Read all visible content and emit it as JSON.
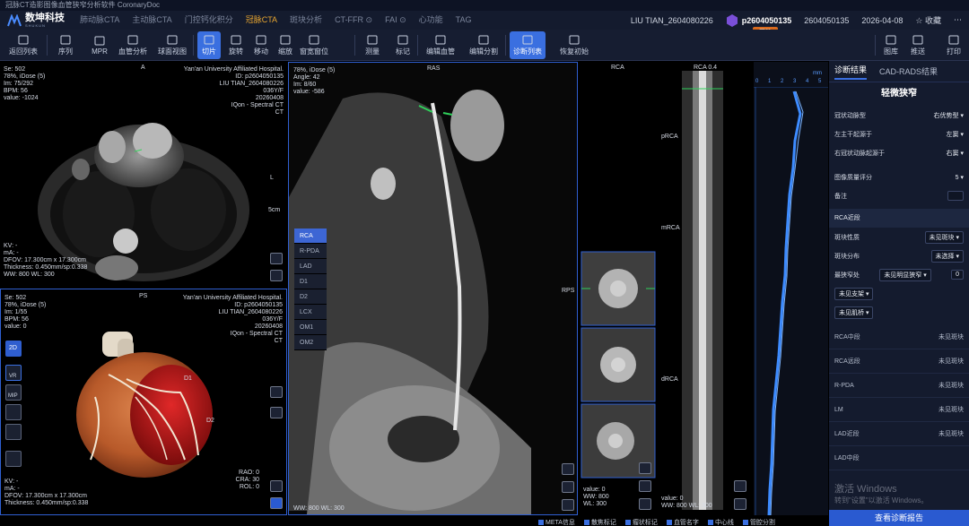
{
  "app": {
    "window_title": "冠脉CT造影图像血管狭窄分析软件 CoronaryDoc"
  },
  "brand": {
    "name": "数坤科技",
    "sub": "SHUKUN"
  },
  "nav": {
    "tabs": [
      "肺动脉CTA",
      "主动脉CTA",
      "门控钙化积分",
      "冠脉CTA",
      "斑块分析",
      "CT-FFR ⊙",
      "FAI ⊙",
      "心功能",
      "TAG"
    ],
    "active_index": 3,
    "user": "LIU TIAN_2604080226",
    "patient_id": "p2604050135",
    "study_id": "2604050135",
    "date": "2026-04-08",
    "favorite_label": "收藏",
    "badge": "冠脉"
  },
  "toolbar": {
    "buttons": [
      {
        "label": "返回列表",
        "icon": "back-icon"
      },
      {
        "label": "序列",
        "icon": "sequence-icon"
      },
      {
        "label": "MPR",
        "icon": "mpr-icon"
      },
      {
        "label": "血管分析",
        "icon": "vessel-analysis-icon"
      },
      {
        "label": "球面视图",
        "icon": "sphere-view-icon"
      },
      {
        "label": "切片",
        "icon": "slice-icon"
      },
      {
        "label": "旋转",
        "icon": "rotate-icon"
      },
      {
        "label": "移动",
        "icon": "move-icon"
      },
      {
        "label": "缩放",
        "icon": "zoom-icon"
      },
      {
        "label": "窗宽窗位",
        "icon": "window-level-icon"
      },
      {
        "label": "测量",
        "icon": "measure-icon"
      },
      {
        "label": "标记",
        "icon": "mark-icon"
      },
      {
        "label": "编辑血管",
        "icon": "edit-vessel-icon"
      },
      {
        "label": "编辑分割",
        "icon": "edit-segmentation-icon"
      },
      {
        "label": "诊断列表",
        "icon": "diagnosis-list-icon"
      },
      {
        "label": "恢复初始",
        "icon": "reset-icon"
      },
      {
        "label": "图库",
        "icon": "gallery-icon"
      },
      {
        "label": "推送",
        "icon": "push-icon"
      },
      {
        "label": "打印",
        "icon": "print-icon"
      }
    ]
  },
  "viewer_axial": {
    "orientation": "A",
    "left_info": [
      "Se: 502",
      "78%, iDose (5)",
      "Im: 75/292",
      "BPM: 56",
      "value: -1024"
    ],
    "right_info": [
      "Yan'an University Affiliated Hospital.",
      "ID: p2604050135",
      "LIU TIAN_2604080226",
      "036Y/F",
      "20260408",
      "IQon - Spectral CT",
      "CT"
    ],
    "bottom_info": [
      "KV: -",
      "mA: -",
      "DFOV: 17.300cm x 17.300cm",
      "Thickness: 0.450mm/sp:0.338",
      "WW: 800    WL: 300"
    ],
    "scale_label": "5cm",
    "left_marker": "L"
  },
  "viewer_3d": {
    "orientation": "PS",
    "left_info": [
      "Se: 502",
      "78%, iDose (5)",
      "Im: 1/55",
      "BPM: 56",
      "value: 0"
    ],
    "right_info": [
      "Yan'an University Affiliated Hospital.",
      "ID: p2604050135",
      "LIU TIAN_2604080226",
      "036Y/F",
      "20260408",
      "IQon - Spectral CT",
      "CT"
    ],
    "bottom_info": [
      "KV: -",
      "mA: -",
      "DFOV: 17.300cm x 17.300cm",
      "Thickness: 0.450mm/sp:0.338"
    ],
    "angles": [
      "RAO: 0",
      "CRA: 30",
      "ROL: 0"
    ],
    "labels": {
      "d1": "D1",
      "d2": "D2"
    },
    "side_tools": [
      "2D",
      "VR",
      "MIP",
      "",
      "",
      ""
    ]
  },
  "viewer_cpr": {
    "orientation": "RAS",
    "left_info": [
      "78%, iDose (5)",
      "Angle: 42",
      "Im: 8/60",
      "value: -586"
    ],
    "bottom_info": "WW: 800    WL: 300",
    "vessels": [
      "RCA",
      "R-PDA",
      "LAD",
      "D1",
      "D2",
      "LCX",
      "OM1",
      "OM2"
    ],
    "active_vessel": "RCA",
    "rps_label": "RPS"
  },
  "viewer_cross": {
    "title": "RCA",
    "bottom_info": [
      "value: 0",
      "WW: 800",
      "WL: 300"
    ]
  },
  "viewer_straight": {
    "title": "RCA 0.4",
    "segments": [
      "pRCA",
      "mRCA",
      "dRCA"
    ],
    "bottom_info": [
      "value: 0",
      "WW: 800    WL: 300"
    ]
  },
  "viewer_graph": {
    "unit": "mm",
    "ticks": [
      "0",
      "1",
      "2",
      "3",
      "4",
      "5"
    ]
  },
  "diagnosis": {
    "tabs": [
      "诊断结果",
      "CAD-RADS结果"
    ],
    "title": "轻微狭窄",
    "rows": [
      {
        "label": "冠状动脉型",
        "value": "右优势型 ▾"
      },
      {
        "label": "左主干起源于",
        "value": "左窦 ▾"
      },
      {
        "label": "右冠状动脉起源于",
        "value": "右窦 ▾"
      }
    ],
    "quality_label": "图像质量评分",
    "quality_value": "5 ▾",
    "note_label": "备注",
    "section": "RCA近段",
    "plaque_nature_label": "斑块性质",
    "plaque_nature_value": "未见斑块 ▾",
    "plaque_dist_label": "斑块分布",
    "plaque_dist_value": "未选择 ▾",
    "stenosis_label": "最狭窄处",
    "stenosis_value": "未见明显狭窄 ▾",
    "stenosis_num": "0",
    "branch_value": "未见支架 ▾",
    "bridge_value": "未见肌桥 ▾",
    "items": [
      {
        "label": "RCA中段",
        "value": "未见斑块"
      },
      {
        "label": "RCA远段",
        "value": "未见斑块"
      },
      {
        "label": "R-PDA",
        "value": "未见斑块"
      },
      {
        "label": "LM",
        "value": "未见斑块"
      },
      {
        "label": "LAD近段",
        "value": "未见斑块"
      },
      {
        "label": "LAD中段",
        "value": ""
      }
    ],
    "footer_button": "查看诊断报告"
  },
  "statusbar": {
    "items": [
      "META信息",
      "散焦标记",
      "瘤状标记",
      "血管名字",
      "中心线",
      "管腔分割"
    ]
  },
  "watermark": {
    "line1": "激活 Windows",
    "line2": "转到\"设置\"以激活 Windows。"
  }
}
